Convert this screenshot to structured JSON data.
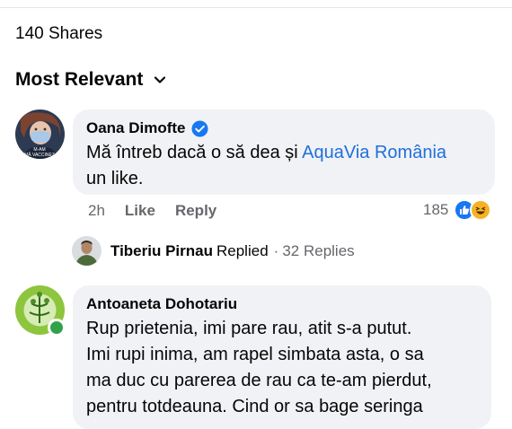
{
  "shares_label": "140 Shares",
  "sort": {
    "label": "Most Relevant"
  },
  "comments": [
    {
      "author": "Oana Dimofte",
      "verified": true,
      "text_prefix": "Mă întreb dacă o să dea și ",
      "mention": "AquaVia România",
      "text_line2": "un like.",
      "avatar_caption_line1": "M-AM",
      "avatar_caption_line2": "MĂ VACCINEZ",
      "time": "2h",
      "like_label": "Like",
      "reply_label": "Reply",
      "reaction_count": "185",
      "reactions": [
        "like-reaction",
        "haha-reaction"
      ],
      "reply_summary": {
        "name": "Tiberiu Pirnau",
        "verb": "Replied",
        "count": "32 Replies"
      }
    },
    {
      "author": "Antoaneta Dohotariu",
      "lines": [
        "Rup prietenia, imi pare rau, atit s-a putut.",
        "Imi rupi inima, am rapel simbata asta, o sa",
        "ma duc cu parerea de rau ca te-am pierdut,",
        "pentru totdeauna. Cind or sa bage seringa"
      ],
      "online": true
    }
  ],
  "colors": {
    "bubble": "#f0f2f5",
    "link": "#216fdb",
    "meta": "#65676b",
    "online": "#31a24c",
    "like": "#1877f2",
    "haha": "#f7b125"
  }
}
